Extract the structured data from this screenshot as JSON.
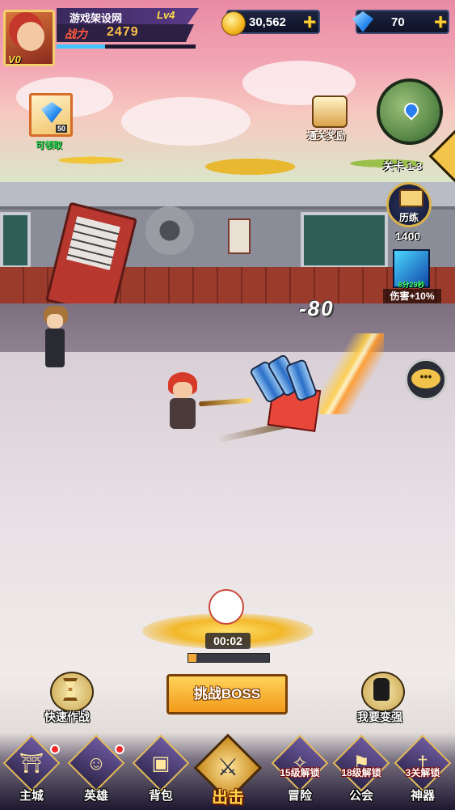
{
  "player": {
    "name": "游戏架设网",
    "level": "Lv4",
    "vip": "V0",
    "power_label": "战力",
    "power_value": "2479",
    "exp_progress": 0.35
  },
  "resources": {
    "gold": "30,562",
    "gems": "70"
  },
  "left_panel": {
    "gift_quantity": "50",
    "gift_label": "可领取"
  },
  "right_panel": {
    "clear_reward_label": "通关奖励",
    "stage_label": "关卡 1-3",
    "training_label": "历练",
    "training_value": "1400",
    "buff_timer": "8分29秒",
    "buff_label": "伤害+10%"
  },
  "battle": {
    "damage_number": "-80"
  },
  "loot": {
    "timer": "00:02",
    "progress": 0.1
  },
  "actions": {
    "quick_battle_label": "快速作战",
    "challenge_boss_label": "挑战BOSS",
    "get_stronger_label": "我要变强"
  },
  "nav": {
    "items": [
      {
        "label": "主城",
        "icon": "castle-icon",
        "lock": "",
        "reddot": true
      },
      {
        "label": "英雄",
        "icon": "hero-portrait-icon",
        "lock": "",
        "reddot": true
      },
      {
        "label": "背包",
        "icon": "backpack-icon",
        "lock": "",
        "reddot": false
      },
      {
        "label": "出击",
        "icon": "crossed-swords-icon",
        "lock": "",
        "reddot": false
      },
      {
        "label": "冒险",
        "icon": "compass-icon",
        "lock": "15级解锁",
        "reddot": false
      },
      {
        "label": "公会",
        "icon": "guild-banner-icon",
        "lock": "18级解锁",
        "reddot": false
      },
      {
        "label": "神器",
        "icon": "artifact-sword-icon",
        "lock": "3关解锁",
        "reddot": false
      }
    ]
  },
  "colors": {
    "gold_accent": "#ffd23a",
    "power_red": "#ff5a3a",
    "gift_label_green": "#2fd452",
    "buff_timer_green": "#3fff6a",
    "boss_button": "#f29a1a"
  }
}
